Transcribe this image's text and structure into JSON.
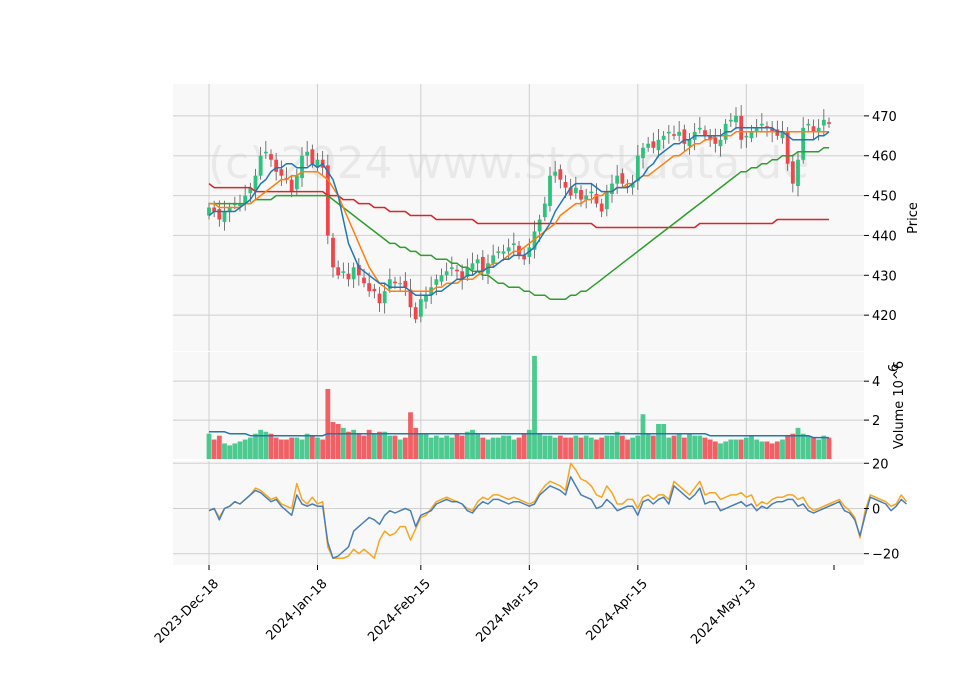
{
  "chart_data": {
    "type": "candlestick",
    "watermark": "(c) 2024 www.stockdata.de",
    "x_ticks": [
      "2023-Dec-18",
      "2024-Jan-18",
      "2024-Feb-15",
      "2024-Mar-15",
      "2024-Apr-15",
      "2024-May-13"
    ],
    "x_tick_index": [
      0,
      21,
      41,
      62,
      83,
      104
    ],
    "colors": {
      "up": "#2ec27e",
      "down": "#f0454a",
      "ma1": "#1f77b4",
      "ma2": "#ff7f0e",
      "ma3": "#2ca02c",
      "ma4": "#d62728",
      "osc1": "#4a7fb5",
      "osc2": "#f5a623"
    },
    "price_panel": {
      "ylabel": "Price",
      "ylim": [
        411,
        478
      ],
      "yticks": [
        "420",
        "430",
        "440",
        "450",
        "460",
        "470"
      ],
      "ytick_values": [
        420,
        430,
        440,
        450,
        460,
        470
      ],
      "close": [
        447,
        446,
        444,
        446,
        447,
        448,
        448,
        450,
        452,
        455,
        460,
        461,
        459,
        456,
        455,
        454,
        451,
        455,
        460,
        461,
        458,
        459,
        457,
        440,
        432,
        430,
        431,
        429,
        432,
        430,
        428,
        426,
        426,
        423,
        426,
        429,
        428,
        428,
        427,
        422,
        419,
        424,
        425,
        427,
        429,
        430,
        431,
        432,
        431,
        429,
        432,
        433,
        434,
        431,
        433,
        435,
        436,
        436,
        437,
        438,
        435,
        434,
        437,
        441,
        444,
        448,
        455,
        456,
        454,
        452,
        450,
        452,
        449,
        450,
        451,
        448,
        446,
        451,
        453,
        455,
        453,
        452,
        453,
        460,
        462,
        463,
        462,
        464,
        465,
        466,
        465,
        466,
        463,
        464,
        466,
        467,
        465,
        464,
        463,
        464,
        468,
        469,
        470,
        464,
        465,
        466,
        467,
        468,
        467,
        466,
        465,
        466,
        458,
        453,
        459,
        467,
        468,
        466,
        467,
        469,
        468
      ],
      "ma_short": [
        445,
        446,
        446,
        446,
        446,
        446,
        447,
        448,
        449,
        451,
        453,
        454,
        456,
        457,
        457,
        458,
        458,
        457,
        457,
        457,
        458,
        457,
        458,
        456,
        454,
        450,
        444,
        438,
        435,
        432,
        431,
        430,
        429,
        428,
        428,
        427,
        427,
        427,
        427,
        426,
        425,
        425,
        425,
        425,
        426,
        426,
        427,
        428,
        429,
        429,
        430,
        430,
        431,
        431,
        432,
        432,
        433,
        434,
        434,
        435,
        435,
        435,
        436,
        437,
        439,
        441,
        443,
        446,
        448,
        450,
        452,
        453,
        453,
        453,
        453,
        452,
        451,
        451,
        451,
        452,
        452,
        452,
        453,
        454,
        455,
        457,
        458,
        460,
        461,
        462,
        463,
        463,
        464,
        464,
        465,
        465,
        465,
        465,
        465,
        465,
        466,
        466,
        467,
        467,
        467,
        467,
        467,
        467,
        467,
        467,
        466,
        466,
        465,
        464,
        464,
        464,
        464,
        464,
        465,
        465,
        466
      ],
      "ma_mid": [
        448,
        448,
        447,
        447,
        447,
        447,
        447,
        448,
        448,
        449,
        450,
        451,
        452,
        453,
        454,
        454,
        455,
        455,
        456,
        456,
        456,
        456,
        455,
        454,
        452,
        450,
        447,
        444,
        441,
        438,
        435,
        432,
        430,
        428,
        427,
        426,
        426,
        426,
        426,
        426,
        426,
        426,
        426,
        426,
        427,
        427,
        428,
        428,
        428,
        429,
        429,
        429,
        430,
        431,
        432,
        433,
        433,
        434,
        435,
        436,
        436,
        437,
        438,
        439,
        440,
        441,
        442,
        443,
        445,
        446,
        447,
        448,
        448,
        449,
        449,
        450,
        450,
        451,
        451,
        452,
        452,
        453,
        453,
        454,
        455,
        455,
        456,
        457,
        458,
        459,
        460,
        460,
        461,
        462,
        463,
        463,
        464,
        464,
        465,
        465,
        465,
        465,
        466,
        466,
        466,
        466,
        466,
        466,
        466,
        466,
        466,
        466,
        466,
        466,
        466,
        466,
        466,
        466,
        466,
        466,
        466
      ],
      "ma_long": [
        448,
        448,
        448,
        448,
        448,
        448,
        448,
        448,
        448,
        449,
        449,
        449,
        449,
        450,
        450,
        450,
        450,
        450,
        450,
        450,
        450,
        450,
        450,
        450,
        449,
        448,
        447,
        446,
        445,
        444,
        443,
        442,
        441,
        440,
        439,
        438,
        438,
        437,
        437,
        436,
        436,
        435,
        435,
        435,
        434,
        434,
        434,
        433,
        433,
        432,
        432,
        431,
        431,
        430,
        430,
        429,
        428,
        428,
        427,
        427,
        427,
        426,
        426,
        425,
        425,
        425,
        424,
        424,
        424,
        424,
        425,
        425,
        426,
        426,
        427,
        428,
        429,
        430,
        431,
        432,
        433,
        434,
        435,
        436,
        437,
        438,
        439,
        440,
        441,
        442,
        443,
        444,
        445,
        446,
        447,
        448,
        449,
        450,
        451,
        452,
        453,
        454,
        455,
        456,
        456,
        457,
        457,
        458,
        458,
        459,
        459,
        460,
        460,
        460,
        461,
        461,
        461,
        461,
        461,
        462,
        462
      ],
      "ma_xlong": [
        453,
        452,
        452,
        452,
        452,
        452,
        452,
        452,
        452,
        451,
        451,
        451,
        451,
        451,
        451,
        451,
        451,
        451,
        451,
        451,
        451,
        451,
        451,
        450,
        450,
        450,
        449,
        449,
        449,
        448,
        448,
        448,
        447,
        447,
        447,
        446,
        446,
        446,
        446,
        445,
        445,
        445,
        445,
        445,
        444,
        444,
        444,
        444,
        444,
        444,
        444,
        444,
        443,
        443,
        443,
        443,
        443,
        443,
        443,
        443,
        443,
        443,
        443,
        443,
        443,
        443,
        443,
        443,
        443,
        443,
        443,
        443,
        443,
        443,
        443,
        442,
        442,
        442,
        442,
        442,
        442,
        442,
        442,
        442,
        442,
        442,
        442,
        442,
        442,
        442,
        442,
        442,
        442,
        442,
        442,
        443,
        443,
        443,
        443,
        443,
        443,
        443,
        443,
        443,
        443,
        443,
        443,
        443,
        443,
        443,
        444,
        444,
        444,
        444,
        444,
        444,
        444,
        444,
        444,
        444,
        444
      ]
    },
    "volume_panel": {
      "ylabel": "Volume  10^6",
      "ylim": [
        0,
        5.5
      ],
      "yticks": [
        "2",
        "4"
      ],
      "ytick_values": [
        2,
        4
      ],
      "volume": [
        1.3,
        1.0,
        1.2,
        0.8,
        0.7,
        0.8,
        0.9,
        1.0,
        1.1,
        1.3,
        1.5,
        1.4,
        1.3,
        1.1,
        1.0,
        1.0,
        1.1,
        1.1,
        1.0,
        1.3,
        1.2,
        1.1,
        1.0,
        3.6,
        1.9,
        1.8,
        1.6,
        1.4,
        1.5,
        1.3,
        1.2,
        1.5,
        1.3,
        1.4,
        1.4,
        1.2,
        1.2,
        1.0,
        1.1,
        2.4,
        1.6,
        1.3,
        1.3,
        1.1,
        1.2,
        1.1,
        1.2,
        1.1,
        1.3,
        1.2,
        1.4,
        1.5,
        1.3,
        1.1,
        1.0,
        1.1,
        1.1,
        1.2,
        1.2,
        1.0,
        1.1,
        1.3,
        1.5,
        5.3,
        1.3,
        1.2,
        1.2,
        1.1,
        1.2,
        1.1,
        1.1,
        1.2,
        1.1,
        1.2,
        1.1,
        1.0,
        1.1,
        1.2,
        1.2,
        1.4,
        1.2,
        1.0,
        1.1,
        1.2,
        2.3,
        1.3,
        1.2,
        1.8,
        1.8,
        1.1,
        1.2,
        1.3,
        1.1,
        1.3,
        1.2,
        1.2,
        1.1,
        1.0,
        0.9,
        0.8,
        0.9,
        1.0,
        1.0,
        1.0,
        1.1,
        1.2,
        1.0,
        0.9,
        0.9,
        0.8,
        0.9,
        1.0,
        1.2,
        1.3,
        1.6,
        1.3,
        1.2,
        1.1,
        1.0,
        1.2,
        1.1
      ],
      "volume_ma": [
        1.4,
        1.4,
        1.4,
        1.4,
        1.3,
        1.3,
        1.3,
        1.3,
        1.2,
        1.2,
        1.2,
        1.2,
        1.2,
        1.2,
        1.2,
        1.2,
        1.2,
        1.2,
        1.2,
        1.2,
        1.2,
        1.2,
        1.2,
        1.3,
        1.3,
        1.3,
        1.3,
        1.3,
        1.3,
        1.3,
        1.3,
        1.3,
        1.3,
        1.3,
        1.3,
        1.3,
        1.3,
        1.3,
        1.3,
        1.3,
        1.3,
        1.3,
        1.3,
        1.3,
        1.3,
        1.3,
        1.3,
        1.3,
        1.3,
        1.3,
        1.3,
        1.3,
        1.3,
        1.3,
        1.3,
        1.3,
        1.3,
        1.3,
        1.3,
        1.3,
        1.3,
        1.3,
        1.3,
        1.3,
        1.3,
        1.3,
        1.3,
        1.3,
        1.3,
        1.3,
        1.3,
        1.3,
        1.3,
        1.3,
        1.3,
        1.3,
        1.3,
        1.3,
        1.3,
        1.3,
        1.3,
        1.3,
        1.3,
        1.3,
        1.3,
        1.3,
        1.3,
        1.3,
        1.3,
        1.3,
        1.3,
        1.3,
        1.3,
        1.3,
        1.3,
        1.3,
        1.3,
        1.2,
        1.2,
        1.2,
        1.2,
        1.2,
        1.2,
        1.2,
        1.2,
        1.2,
        1.2,
        1.2,
        1.2,
        1.2,
        1.2,
        1.2,
        1.2,
        1.2,
        1.2,
        1.2,
        1.2,
        1.1,
        1.1,
        1.1,
        1.1
      ]
    },
    "osc_panel": {
      "ylim": [
        -25,
        21
      ],
      "yticks": [
        "−20",
        "0",
        "20"
      ],
      "ytick_values": [
        -20,
        0,
        20
      ],
      "line1": [
        -1,
        0,
        -5,
        0,
        1,
        3,
        2,
        4,
        6,
        8,
        7,
        5,
        3,
        4,
        1,
        -1,
        -3,
        6,
        2,
        1,
        2,
        1,
        1,
        -15,
        -22,
        -21,
        -19,
        -17,
        -10,
        -8,
        -6,
        -4,
        -5,
        -7,
        -3,
        -1,
        -2,
        -1,
        0,
        -1,
        -8,
        -3,
        -2,
        -1,
        2,
        3,
        4,
        3,
        3,
        2,
        -1,
        -2,
        1,
        3,
        2,
        4,
        4,
        3,
        2,
        3,
        3,
        2,
        1,
        2,
        6,
        8,
        10,
        9,
        8,
        6,
        14,
        10,
        6,
        5,
        4,
        0,
        1,
        4,
        2,
        -1,
        0,
        1,
        1,
        -3,
        3,
        4,
        2,
        4,
        5,
        2,
        10,
        8,
        6,
        4,
        6,
        9,
        2,
        3,
        3,
        -1,
        0,
        1,
        2,
        3,
        1,
        2,
        -1,
        1,
        0,
        2,
        3,
        3,
        4,
        4,
        1,
        2,
        -1,
        -2,
        -1,
        0,
        1,
        2,
        3,
        -1,
        -2,
        -5,
        -12,
        -3,
        5,
        4,
        3,
        2,
        -1,
        1,
        4,
        2
      ],
      "line2": [
        -1,
        0,
        -4,
        0,
        1,
        3,
        2,
        4,
        6,
        9,
        8,
        6,
        4,
        5,
        2,
        1,
        0,
        11,
        4,
        2,
        5,
        2,
        3,
        -17,
        -22,
        -22,
        -22,
        -21,
        -18,
        -20,
        -18,
        -20,
        -22,
        -14,
        -10,
        -12,
        -11,
        -8,
        -8,
        -14,
        -9,
        -4,
        -3,
        0,
        3,
        4,
        5,
        4,
        3,
        2,
        0,
        -1,
        3,
        5,
        4,
        6,
        6,
        5,
        4,
        5,
        4,
        3,
        2,
        3,
        7,
        10,
        12,
        11,
        10,
        8,
        20,
        17,
        13,
        12,
        10,
        6,
        5,
        10,
        7,
        2,
        2,
        4,
        4,
        0,
        5,
        6,
        4,
        6,
        6,
        4,
        12,
        10,
        8,
        6,
        9,
        12,
        6,
        7,
        7,
        4,
        5,
        6,
        6,
        7,
        5,
        6,
        1,
        3,
        2,
        4,
        5,
        5,
        6,
        6,
        4,
        5,
        1,
        -1,
        0,
        1,
        2,
        3,
        4,
        1,
        -1,
        -4,
        -13,
        -1,
        6,
        5,
        4,
        3,
        1,
        2,
        6,
        3
      ]
    }
  }
}
